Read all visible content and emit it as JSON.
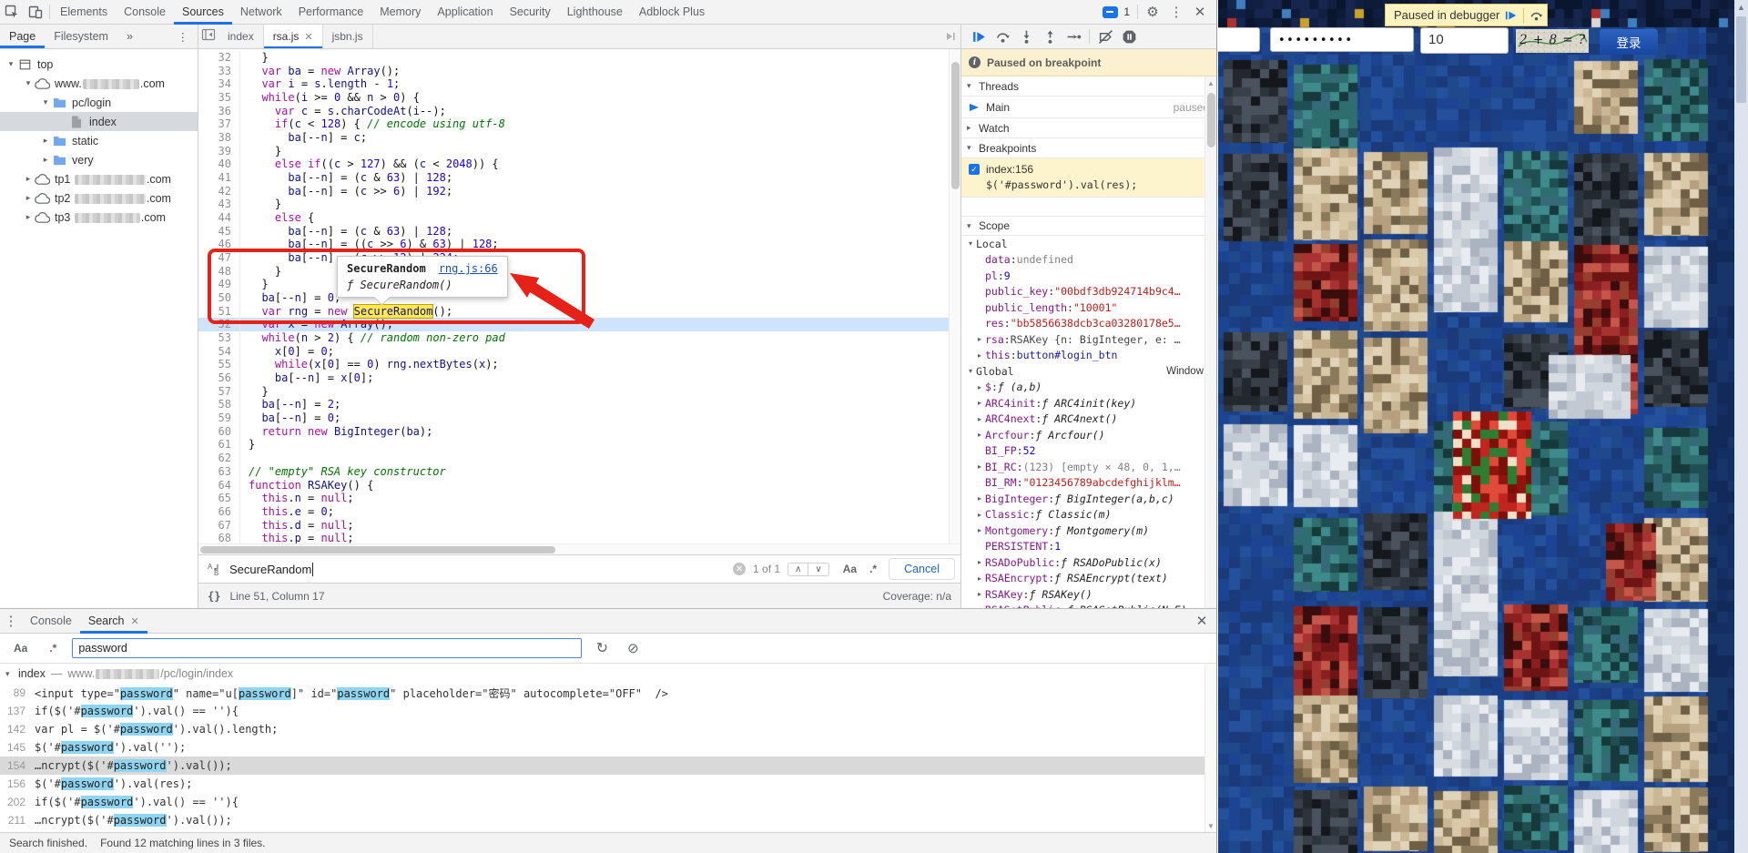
{
  "colors": {
    "accent_blue": "#1a73e8",
    "match_yellow": "#ffea4d",
    "result_highlight": "#8fd4f0",
    "breakpoint_bg": "#fdf3cd",
    "banner_bg": "#fbf0cf",
    "selected_line_blue": "#cfe3fc",
    "annotation_red": "#e62117",
    "page_base_blue": "#1d4492",
    "login_button_blue": "#17479e"
  },
  "icons": {
    "more": "⋮",
    "chevrons": "»",
    "close": "✕",
    "gear": "⚙",
    "braces": "{}",
    "case_sensitive": "Aa",
    "regex": ".*",
    "prev": "∧",
    "next": "∨",
    "refresh": "↻",
    "block": "⊘",
    "clear": "✕",
    "up_arrow": "▲",
    "down_arrow": "▼",
    "tri_open": "▾",
    "tri_closed": "▸",
    "check": "✓",
    "info": "i"
  },
  "devtools": {
    "main_tabs": [
      "Elements",
      "Console",
      "Sources",
      "Network",
      "Performance",
      "Memory",
      "Application",
      "Security",
      "Lighthouse",
      "Adblock Plus"
    ],
    "main_tabs_active": "Sources",
    "badge_count": "1",
    "nav_tabs": {
      "page": "Page",
      "filesystem": "Filesystem"
    },
    "editor_tabs": [
      {
        "label": "index",
        "active": false,
        "close": false
      },
      {
        "label": "rsa.js",
        "active": true,
        "close": true
      },
      {
        "label": "jsbn.js",
        "active": false,
        "close": false
      }
    ],
    "file_tree": [
      {
        "indent": 0,
        "arrow": "open",
        "icon": "frame",
        "pre": "top"
      },
      {
        "indent": 1,
        "arrow": "open",
        "icon": "cloud",
        "pre": "www.",
        "blur": 62,
        "post": ".com"
      },
      {
        "indent": 2,
        "arrow": "open",
        "icon": "folder-open",
        "pre": "pc/login"
      },
      {
        "indent": 3,
        "arrow": "none",
        "icon": "file",
        "pre": "index",
        "selected": true
      },
      {
        "indent": 2,
        "arrow": "closed",
        "icon": "folder",
        "pre": "static"
      },
      {
        "indent": 2,
        "arrow": "closed",
        "icon": "folder",
        "pre": "very"
      },
      {
        "indent": 1,
        "arrow": "closed",
        "icon": "cloud",
        "pre": "tp1 ",
        "blur": 78,
        "post": ".com"
      },
      {
        "indent": 1,
        "arrow": "closed",
        "icon": "cloud",
        "pre": "tp2 ",
        "blur": 78,
        "post": ".com"
      },
      {
        "indent": 1,
        "arrow": "closed",
        "icon": "cloud",
        "pre": "tp3 ",
        "blur": 72,
        "post": ".com"
      }
    ],
    "editor": {
      "first_line": 32,
      "keywords": [
        "var",
        "new",
        "while",
        "if",
        "else",
        "return",
        "function",
        "null",
        "this"
      ],
      "find_match": {
        "token": "SecureRandom",
        "line": 51
      },
      "selected_line": 52,
      "code_lines": [
        "  }",
        "  var ba = new Array();",
        "  var i = s.length - 1;",
        "  while(i >= 0 && n > 0) {",
        "    var c = s.charCodeAt(i--);",
        "    if(c < 128) { // encode using utf-8",
        "      ba[--n] = c;",
        "    }",
        "    else if((c > 127) && (c < 2048)) {",
        "      ba[--n] = (c & 63) | 128;",
        "      ba[--n] = (c >> 6) | 192;",
        "    }",
        "    else {",
        "      ba[--n] = (c & 63) | 128;",
        "      ba[--n] = ((c >> 6) & 63) | 128;",
        "      ba[--n] = (c >> 12) | 224;",
        "    }",
        "  }",
        "  ba[--n] = 0;",
        "  var rng = new SecureRandom();",
        "  var x = new Array();",
        "  while(n > 2) { // random non-zero pad",
        "    x[0] = 0;",
        "    while(x[0] == 0) rng.nextBytes(x);",
        "    ba[--n] = x[0];",
        "  }",
        "  ba[--n] = 2;",
        "  ba[--n] = 0;",
        "  return new BigInteger(ba);",
        "}",
        "",
        "// \"empty\" RSA key constructor",
        "function RSAKey() {",
        "  this.n = null;",
        "  this.e = 0;",
        "  this.d = null;",
        "  this.p = null;"
      ]
    },
    "tooltip": {
      "title": "SecureRandom",
      "link": "rng.js:66",
      "signature": "ƒ SecureRandom()"
    },
    "find": {
      "query": "SecureRandom",
      "matches": "1 of 1",
      "cancel": "Cancel"
    },
    "status": {
      "position": "Line 51, Column 17",
      "coverage": "Coverage: n/a"
    },
    "debugger": {
      "banner": "Paused on breakpoint",
      "threads_label": "Threads",
      "thread_name": "Main",
      "thread_state": "paused",
      "watch_label": "Watch",
      "breakpoints_label": "Breakpoints",
      "breakpoint": {
        "location": "index:156",
        "code": "$('#password').val(res);"
      },
      "scope_label": "Scope",
      "local_label": "Local",
      "global_label": "Global",
      "global_value": "Window",
      "local": [
        {
          "arrow": 0,
          "k": "data",
          "v": "undefined",
          "c": "dim"
        },
        {
          "arrow": 0,
          "k": "pl",
          "v": "9",
          "c": "num"
        },
        {
          "arrow": 0,
          "k": "public_key",
          "v": "\"00bdf3db924714b9c4…",
          "c": "str"
        },
        {
          "arrow": 0,
          "k": "public_length",
          "v": "\"10001\"",
          "c": "str"
        },
        {
          "arrow": 0,
          "k": "res",
          "v": "\"bb5856638dcb3ca03280178e5…",
          "c": "str"
        },
        {
          "arrow": 1,
          "k": "rsa",
          "v": "RSAKey {n: BigInteger, e: …",
          "c": "preview"
        },
        {
          "arrow": 1,
          "k": "this",
          "v": "button#login_btn",
          "c": "node"
        }
      ],
      "global": [
        {
          "arrow": 1,
          "k": "$",
          "v": "ƒ (a,b)",
          "c": "fn"
        },
        {
          "arrow": 1,
          "k": "ARC4init",
          "v": "ƒ ARC4init(key)",
          "c": "fn"
        },
        {
          "arrow": 1,
          "k": "ARC4next",
          "v": "ƒ ARC4next()",
          "c": "fn"
        },
        {
          "arrow": 1,
          "k": "Arcfour",
          "v": "ƒ Arcfour()",
          "c": "fn"
        },
        {
          "arrow": 0,
          "k": "BI_FP",
          "v": "52",
          "c": "num"
        },
        {
          "arrow": 1,
          "k": "BI_RC",
          "v": "(123) [empty × 48, 0, 1,…",
          "c": "dim"
        },
        {
          "arrow": 0,
          "k": "BI_RM",
          "v": "\"0123456789abcdefghijklm…",
          "c": "str"
        },
        {
          "arrow": 1,
          "k": "BigInteger",
          "v": "ƒ BigInteger(a,b,c)",
          "c": "fn"
        },
        {
          "arrow": 1,
          "k": "Classic",
          "v": "ƒ Classic(m)",
          "c": "fn"
        },
        {
          "arrow": 1,
          "k": "Montgomery",
          "v": "ƒ Montgomery(m)",
          "c": "fn"
        },
        {
          "arrow": 0,
          "k": "PERSISTENT",
          "v": "1",
          "c": "num"
        },
        {
          "arrow": 1,
          "k": "RSADoPublic",
          "v": "ƒ RSADoPublic(x)",
          "c": "fn"
        },
        {
          "arrow": 1,
          "k": "RSAEncrypt",
          "v": "ƒ RSAEncrypt(text)",
          "c": "fn"
        },
        {
          "arrow": 1,
          "k": "RSAKey",
          "v": "ƒ RSAKey()",
          "c": "fn"
        },
        {
          "arrow": 1,
          "k": "RSASetPublic",
          "v": "ƒ RSASetPublic(N,E)",
          "c": "fn"
        }
      ]
    },
    "drawer": {
      "console_label": "Console",
      "search_label": "Search",
      "search_value": "password",
      "result_header": {
        "file": "index",
        "sep": "—",
        "pre": "www.",
        "blur": 70,
        "post": "/pc/login/index"
      },
      "results": [
        {
          "line": "89",
          "selected": false,
          "parts": [
            {
              "t": "<input type=\""
            },
            {
              "t": "password",
              "h": 1
            },
            {
              "t": "\" name=\"u["
            },
            {
              "t": "password",
              "h": 1
            },
            {
              "t": "]\" id=\""
            },
            {
              "t": "password",
              "h": 1
            },
            {
              "t": "\" placeholder=\"密码\" autocomplete=\"OFF\"  />"
            }
          ]
        },
        {
          "line": "137",
          "selected": false,
          "parts": [
            {
              "t": "if($('#"
            },
            {
              "t": "password",
              "h": 1
            },
            {
              "t": "').val() == ''){"
            }
          ]
        },
        {
          "line": "142",
          "selected": false,
          "parts": [
            {
              "t": "var pl = $('#"
            },
            {
              "t": "password",
              "h": 1
            },
            {
              "t": "').val().length;"
            }
          ]
        },
        {
          "line": "145",
          "selected": false,
          "parts": [
            {
              "t": "$('#"
            },
            {
              "t": "password",
              "h": 1
            },
            {
              "t": "').val('');"
            }
          ]
        },
        {
          "line": "154",
          "selected": true,
          "parts": [
            {
              "t": "…ncrypt($('#"
            },
            {
              "t": "password",
              "h": 1
            },
            {
              "t": "').val());"
            }
          ]
        },
        {
          "line": "156",
          "selected": false,
          "parts": [
            {
              "t": "$('#"
            },
            {
              "t": "password",
              "h": 1
            },
            {
              "t": "').val(res);"
            }
          ]
        },
        {
          "line": "202",
          "selected": false,
          "parts": [
            {
              "t": "if($('#"
            },
            {
              "t": "password",
              "h": 1
            },
            {
              "t": "').val() == ''){"
            }
          ]
        },
        {
          "line": "211",
          "selected": false,
          "parts": [
            {
              "t": "…ncrypt($('#"
            },
            {
              "t": "password",
              "h": 1
            },
            {
              "t": "').val());"
            }
          ]
        }
      ],
      "status_left": "Search finished.",
      "status_right": "Found 12 matching lines in 3 files."
    }
  },
  "webpage": {
    "toast_label": "Paused in debugger",
    "login": {
      "password_dots": "•••••••••",
      "amount": "10",
      "captcha": "2 + 8 = ?",
      "button": "登录"
    },
    "mosaic": {
      "base": [
        "#1d4492",
        "#20498c",
        "#1b3f85",
        "#24509c",
        "#1a3a7a"
      ],
      "margin": [
        "#142f63",
        "#173569",
        "#112a5a"
      ],
      "header": [
        "#0d1b38",
        "#111f42",
        "#0a152e",
        "#16264e"
      ],
      "pop": [
        "#b03030",
        "#c9a227",
        "#3f7fbf",
        "#d8d8d8"
      ],
      "red": [
        "#8a1f1f",
        "#a83232",
        "#6e1414",
        "#c4574a",
        "#3a0d0d",
        "#963f2e"
      ],
      "redBright": [
        "#c02520",
        "#e04a38",
        "#8f1410",
        "#2e7d32",
        "#f0e0c8",
        "#7a1008"
      ],
      "tan": [
        "#c9b795",
        "#b59f7e",
        "#8a7a5c",
        "#e0d3b8",
        "#6e5f45",
        "#d9c9a8"
      ],
      "dark": [
        "#23282e",
        "#3a404a",
        "#14171c",
        "#4a525e",
        "#2e343c"
      ],
      "teal": [
        "#2e6e6e",
        "#1f4f52",
        "#3f8a8a",
        "#163a3c",
        "#356a78"
      ],
      "light": [
        "#d8dde2",
        "#c2c9d2",
        "#e8ecf0",
        "#aab3bf",
        "#cfd6de"
      ]
    }
  }
}
